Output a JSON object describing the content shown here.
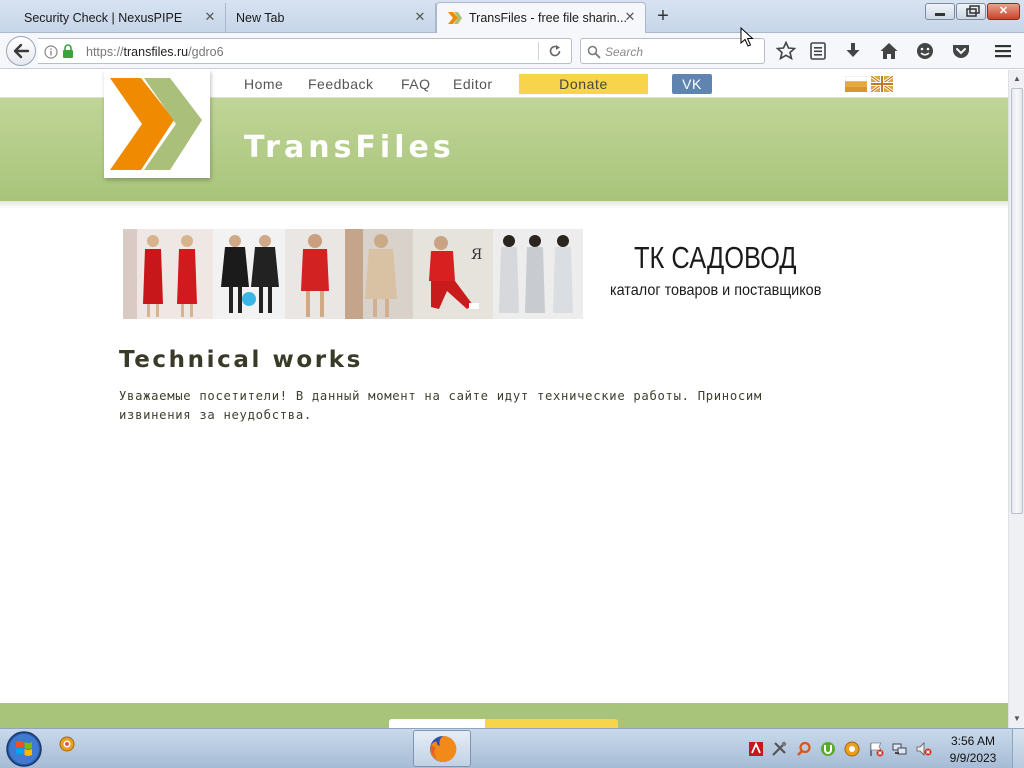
{
  "browser": {
    "tabs": [
      {
        "title": "Security Check | NexusPIPE",
        "active": false
      },
      {
        "title": "New Tab",
        "active": false
      },
      {
        "title": "TransFiles - free file sharin...",
        "active": true
      }
    ],
    "new_tab_symbol": "+",
    "close_symbol": "✕",
    "url_scheme": "https://",
    "url_host": "transfiles.ru",
    "url_path": "/gdro6",
    "search_placeholder": "Search",
    "toolbar_icons": [
      "bookmark-star-icon",
      "reading-list-icon",
      "download-icon",
      "home-icon",
      "smiley-icon",
      "pocket-icon",
      "menu-icon"
    ]
  },
  "site": {
    "nav": {
      "home": "Home",
      "feedback": "Feedback",
      "faq": "FAQ",
      "editor": "Editor",
      "donate": "Donate",
      "vk": "VK"
    },
    "title": "TransFiles",
    "ad": {
      "title": "ТК САДОВОД",
      "subtitle": "каталог товаров и поставщиков"
    },
    "heading": "Technical works",
    "message": "Уважаемые посетители! В данный момент на сайте идут технические работы. Приносим извинения за неудобства.",
    "colors": {
      "header_green": "#a8c47a",
      "donate_yellow": "#f8d44a",
      "vk_blue": "#5f84b0",
      "logo_orange": "#f08a00",
      "logo_green": "#a9bf7a"
    }
  },
  "taskbar": {
    "time": "3:56 AM",
    "date": "9/9/2023"
  }
}
